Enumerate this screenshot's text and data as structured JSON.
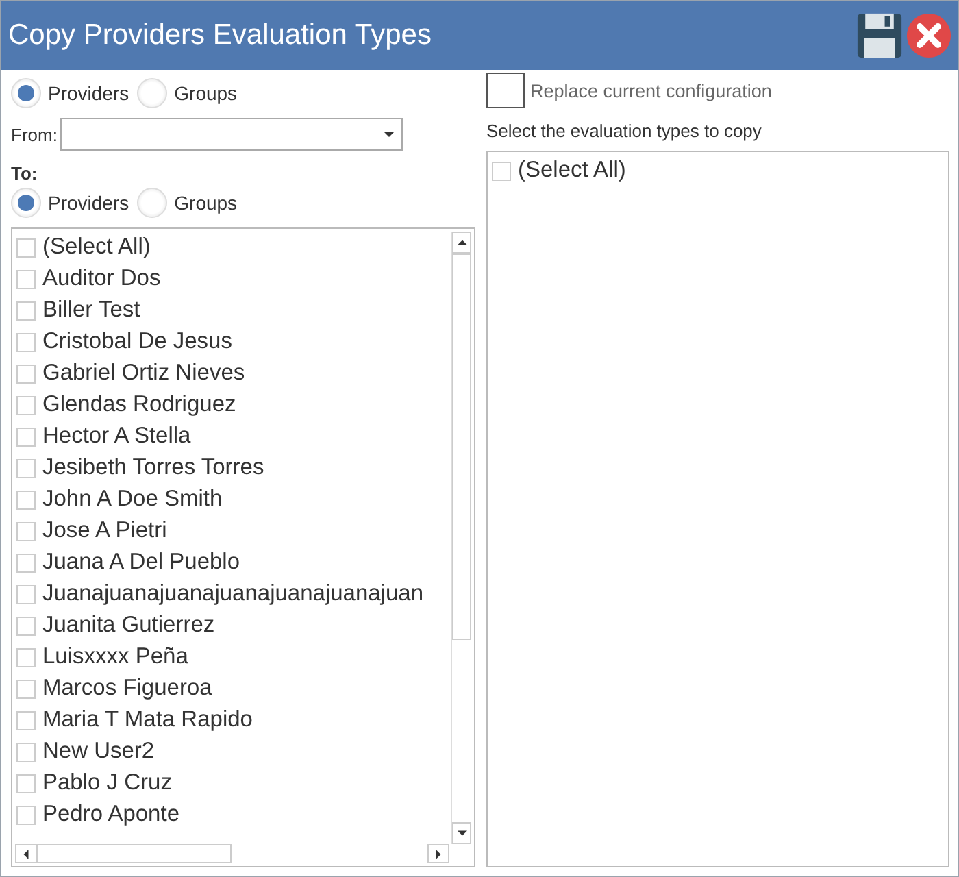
{
  "window": {
    "title": "Copy Providers Evaluation Types"
  },
  "source_type": [
    {
      "label": "Providers",
      "selected": true
    },
    {
      "label": "Groups",
      "selected": false
    }
  ],
  "from": {
    "label": "From:"
  },
  "to": {
    "label": "To:"
  },
  "target_type": [
    {
      "label": "Providers",
      "selected": true
    },
    {
      "label": "Groups",
      "selected": false
    }
  ],
  "providers": [
    {
      "label": "(Select All)",
      "checked": false
    },
    {
      "label": "Auditor Dos",
      "checked": false
    },
    {
      "label": "Biller Test",
      "checked": false
    },
    {
      "label": "Cristobal De Jesus",
      "checked": false
    },
    {
      "label": "Gabriel Ortiz Nieves",
      "checked": false
    },
    {
      "label": "Glendas Rodriguez",
      "checked": false
    },
    {
      "label": "Hector A Stella",
      "checked": false
    },
    {
      "label": "Jesibeth Torres Torres",
      "checked": false
    },
    {
      "label": "John A Doe Smith",
      "checked": false
    },
    {
      "label": "Jose A Pietri",
      "checked": false
    },
    {
      "label": "Juana A Del Pueblo",
      "checked": false
    },
    {
      "label": "Juanajuanajuanajuanajuanajuanajuan",
      "checked": false
    },
    {
      "label": "Juanita Gutierrez",
      "checked": false
    },
    {
      "label": "Luisxxxx Peña",
      "checked": false
    },
    {
      "label": "Marcos Figueroa",
      "checked": false
    },
    {
      "label": "Maria T Mata Rapido",
      "checked": false
    },
    {
      "label": "New User2",
      "checked": false
    },
    {
      "label": "Pablo J Cruz",
      "checked": false
    },
    {
      "label": "Pedro Aponte",
      "checked": false
    }
  ],
  "replace": {
    "label": "Replace current configuration",
    "checked": false
  },
  "types_label": "Select the evaluation types to copy",
  "types": [
    {
      "label": "(Select All)",
      "checked": false
    }
  ]
}
